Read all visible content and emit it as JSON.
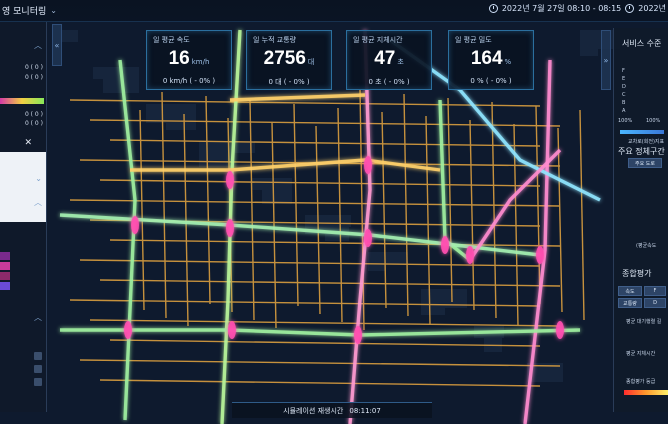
{
  "header": {
    "title": "영 모니터링",
    "datetime": "2022년 7월 27일 08:10 - 08:15",
    "datetime_right": "2022년"
  },
  "kpis": [
    {
      "label": "일 평균 속도",
      "value": "16",
      "unit": "km/h",
      "sub": "0 km/h ( - 0% )"
    },
    {
      "label": "일 누적 교통량",
      "value": "2756",
      "unit": "대",
      "sub": "0 대 ( - 0% )"
    },
    {
      "label": "일 평균 지체시간",
      "value": "47",
      "unit": "초",
      "sub": "0 초 ( - 0% )"
    },
    {
      "label": "일 평균 밀도",
      "value": "164",
      "unit": "%",
      "sub": "0 % ( - 0% )"
    }
  ],
  "left_panel": {
    "row1": "0 ( 0 )",
    "row2": "0 ( 0 )",
    "row3": "0 ( 0 )",
    "row4": "0 ( 0 )"
  },
  "right_panel": {
    "service_level_title": "서비스 수준",
    "grades": [
      "F",
      "E",
      "D",
      "C",
      "B",
      "A"
    ],
    "pct_left": "100%",
    "pct_right": "100%",
    "bar_caption": "교차로(회전)지표",
    "major_title": "주요 정체구간",
    "major_button": "주요 도로",
    "side_note": "(평균속도",
    "eval_title": "종합평가",
    "eval_btn1": "속도",
    "eval_btn1_grade": "F",
    "eval_btn2": "교통량",
    "eval_btn2_grade": "D",
    "eval_text1": "평균 대기행렬 길",
    "eval_text2": "평균 지체시간",
    "eval_grade_label": "종합평가 등급"
  },
  "simulation": {
    "label": "시뮬레이션 재생시간",
    "time": "08:11:07"
  },
  "colors": {
    "accent": "#2b6f9e",
    "congestion": "#ff3fa8",
    "free_flow": "#7ee86a"
  }
}
